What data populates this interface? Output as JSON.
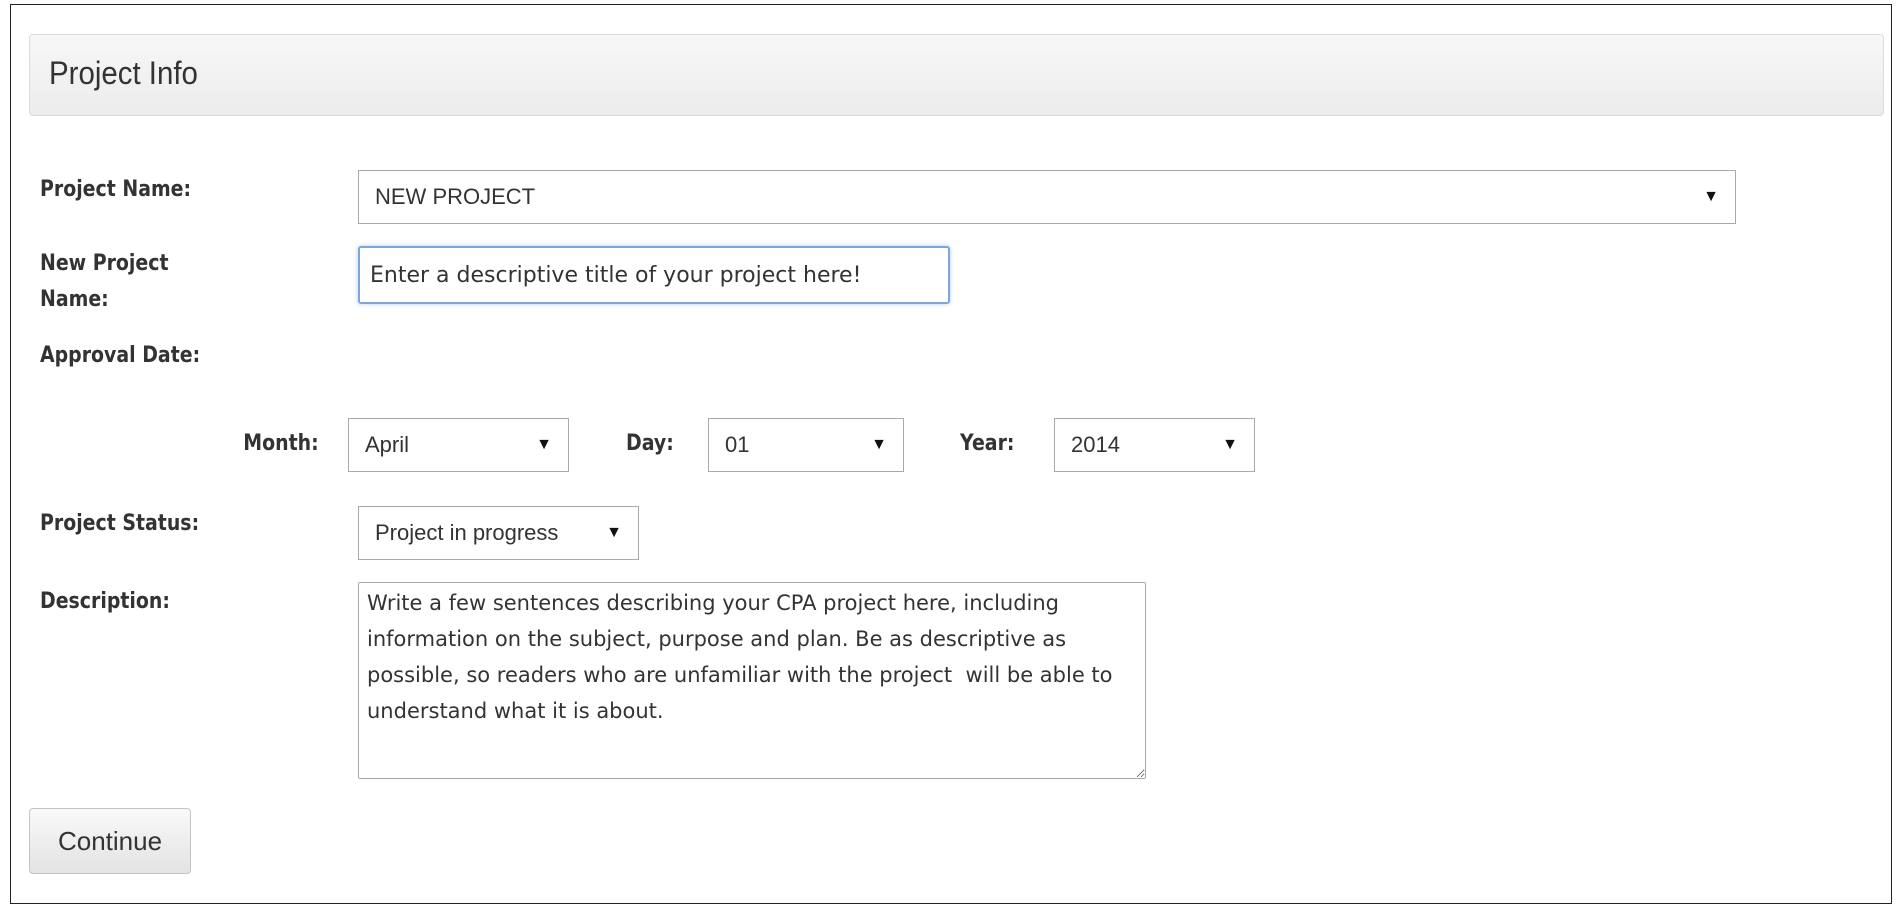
{
  "panel": {
    "title": "Project Info"
  },
  "form": {
    "project_name": {
      "label": "Project Name:",
      "value": "NEW PROJECT"
    },
    "new_project_name": {
      "label_line1": "New Project",
      "label_line2": "Name:",
      "value": "Enter a descriptive title of your project here!"
    },
    "approval_date": {
      "label": "Approval Date:",
      "month_label": "Month:",
      "month_value": "April",
      "day_label": "Day:",
      "day_value": "01",
      "year_label": "Year:",
      "year_value": "2014"
    },
    "project_status": {
      "label": "Project Status:",
      "value": "Project in progress"
    },
    "description": {
      "label": "Description:",
      "value": "Write a few sentences describing your CPA project here, including information on the subject, purpose and plan. Be as descriptive as possible, so readers who are unfamiliar with the project  will be able to understand what it is about."
    }
  },
  "actions": {
    "continue_label": "Continue"
  },
  "icons": {
    "dropdown_caret": "▼"
  }
}
